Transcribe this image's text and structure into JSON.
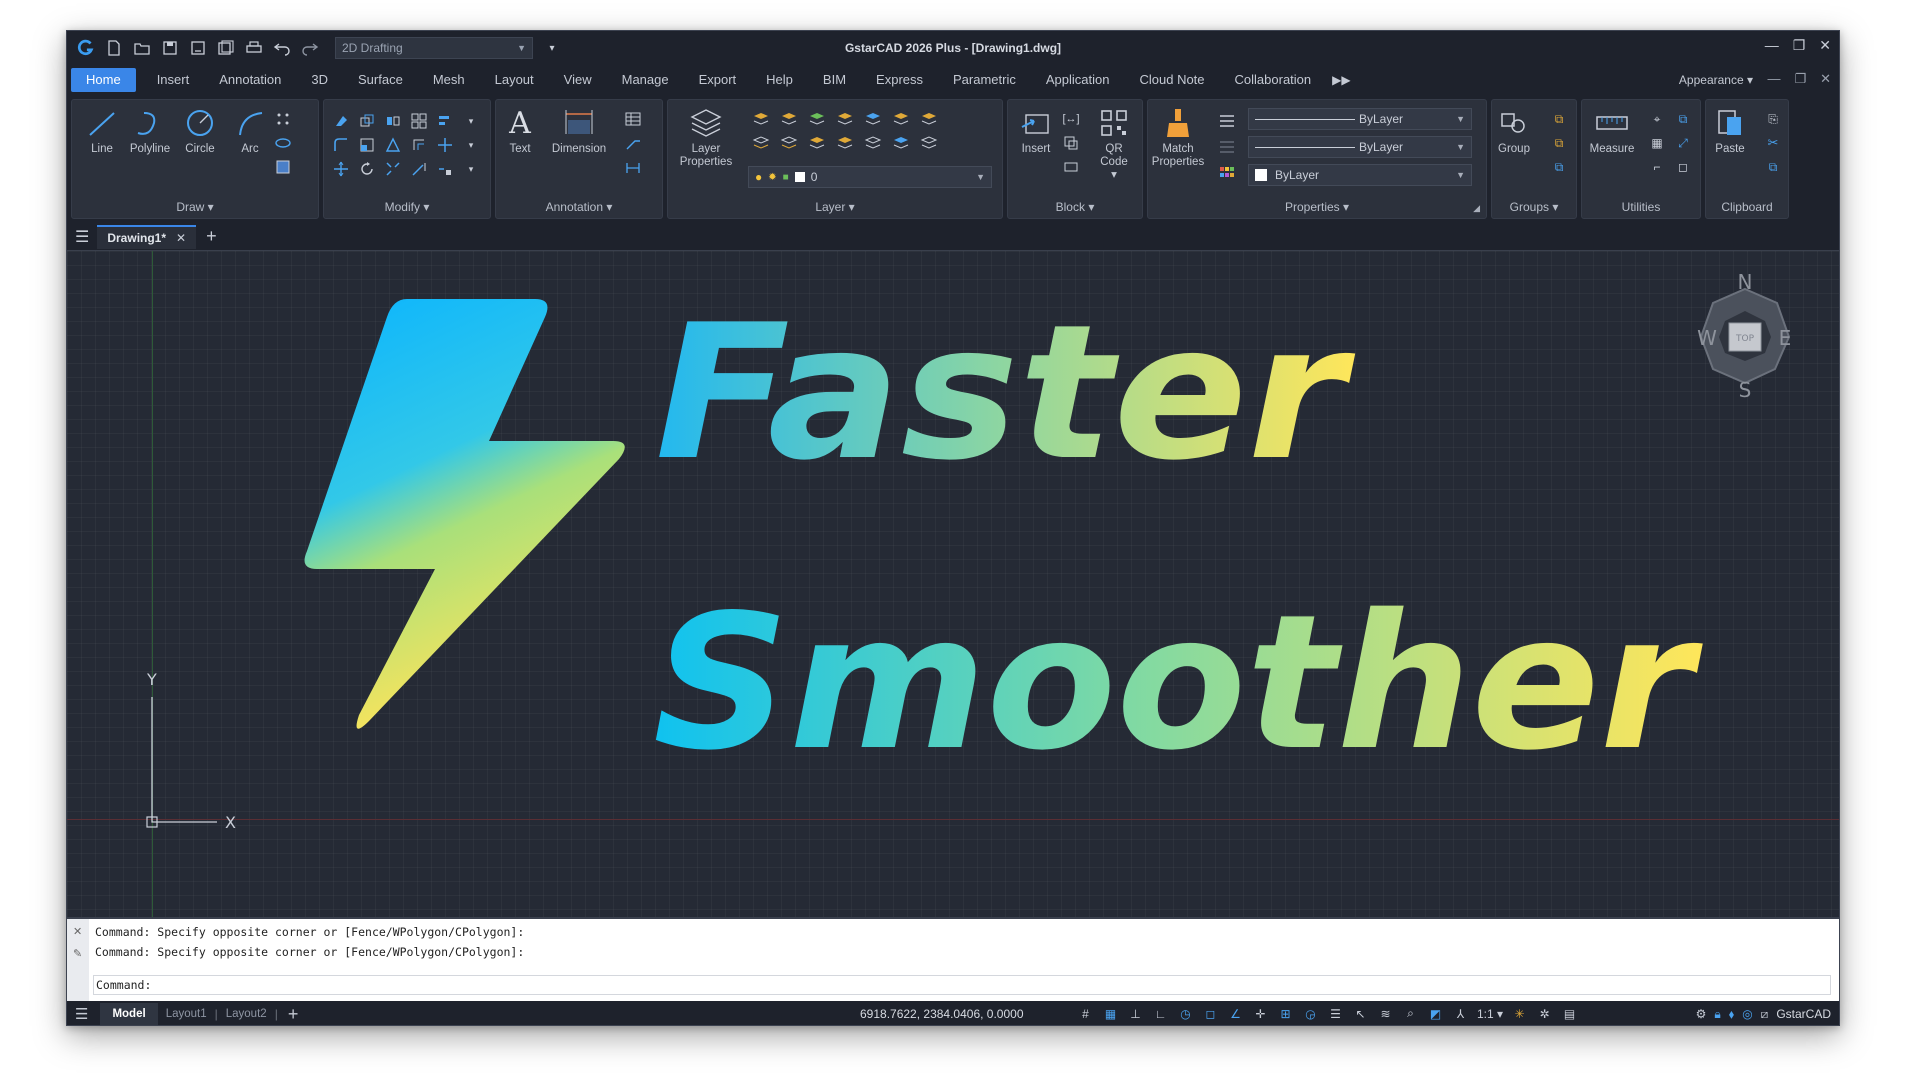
{
  "app": {
    "title": "GstarCAD 2026 Plus - [Drawing1.dwg]",
    "workspace": "2D Drafting",
    "appearance_label": "Appearance ▾"
  },
  "menu": {
    "tabs": [
      "Home",
      "Insert",
      "Annotation",
      "3D",
      "Surface",
      "Mesh",
      "Layout",
      "View",
      "Manage",
      "Export",
      "Help",
      "BIM",
      "Express",
      "Parametric",
      "Application",
      "Cloud Note",
      "Collaboration"
    ],
    "active": "Home"
  },
  "ribbon": {
    "draw": {
      "title": "Draw ▾",
      "line": "Line",
      "polyline": "Polyline",
      "circle": "Circle",
      "arc": "Arc"
    },
    "modify": {
      "title": "Modify ▾"
    },
    "annotation": {
      "title": "Annotation ▾",
      "text": "Text",
      "dimension": "Dimension"
    },
    "layer": {
      "title": "Layer ▾",
      "layer_properties": "Layer Properties",
      "current_layer": "0"
    },
    "block": {
      "title": "Block ▾",
      "insert": "Insert",
      "qr_code": "QR Code ▾"
    },
    "properties": {
      "title": "Properties ▾",
      "match": "Match Properties",
      "linetype": "ByLayer",
      "lineweight": "ByLayer",
      "color": "ByLayer"
    },
    "groups": {
      "title": "Groups ▾",
      "group": "Group"
    },
    "utilities": {
      "title": "Utilities",
      "measure": "Measure"
    },
    "clipboard": {
      "title": "Clipboard",
      "paste": "Paste"
    }
  },
  "document_tabs": {
    "active": "Drawing1*"
  },
  "canvas": {
    "headline_1": "Faster",
    "headline_2": "Smoother",
    "ucs_x": "X",
    "ucs_y": "Y",
    "viewcube": {
      "n": "N",
      "s": "S",
      "e": "E",
      "w": "W",
      "top": "TOP"
    },
    "gradient_start": "#12bdf2",
    "gradient_end": "#fde75a"
  },
  "command": {
    "history": [
      "Command: Specify opposite corner or [Fence/WPolygon/CPolygon]:",
      "Command: Specify opposite corner or [Fence/WPolygon/CPolygon]:"
    ],
    "prompt": "Command:"
  },
  "status": {
    "layout_tabs": [
      "Model",
      "Layout1",
      "Layout2"
    ],
    "coordinates": "6918.7622, 2384.0406, 0.0000",
    "scale": "1:1 ▾",
    "brand": "GstarCAD"
  }
}
